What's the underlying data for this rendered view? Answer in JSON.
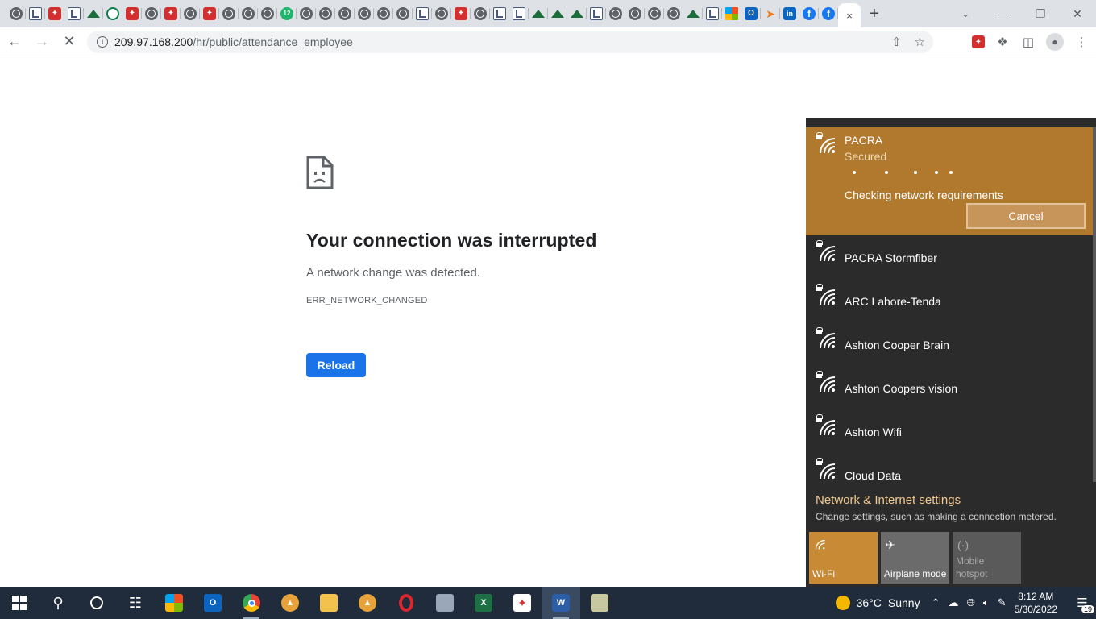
{
  "browser": {
    "tab_icons": [
      "globe",
      "doc",
      "pdf",
      "doc",
      "green",
      "ring",
      "pdf",
      "globe",
      "pdf",
      "globe",
      "pdf",
      "globe",
      "globe",
      "globe",
      "badge12",
      "globe",
      "globe",
      "globe",
      "globe",
      "globe",
      "globe",
      "doc",
      "globe",
      "pdf",
      "globe",
      "doc",
      "doc",
      "green",
      "green",
      "green",
      "doc",
      "globe",
      "globe",
      "globe",
      "globe",
      "green",
      "doc",
      "ms",
      "outlook",
      "arrow",
      "li",
      "fb",
      "fb"
    ],
    "tab_badge_text": "12",
    "active_tab_close": "×",
    "new_tab": "+",
    "url_host": "209.97.168.200",
    "url_path": "/hr/public/attendance_employee"
  },
  "error_page": {
    "title": "Your connection was interrupted",
    "description": "A network change was detected.",
    "code": "ERR_NETWORK_CHANGED",
    "reload_label": "Reload"
  },
  "network_flyout": {
    "active_network": {
      "name": "PACRA",
      "status": "Secured",
      "progress_text": "Checking network requirements",
      "cancel_label": "Cancel"
    },
    "networks": [
      {
        "name": "PACRA Stormfiber"
      },
      {
        "name": "ARC Lahore-Tenda"
      },
      {
        "name": "Ashton Cooper Brain"
      },
      {
        "name": "Ashton Coopers vision"
      },
      {
        "name": "Ashton Wifi"
      },
      {
        "name": "Cloud Data"
      }
    ],
    "settings_link": "Network & Internet settings",
    "settings_sub": "Change settings, such as making a connection metered.",
    "quick_actions": {
      "wifi": "Wi-Fi",
      "airplane": "Airplane mode",
      "hotspot_line1": "Mobile",
      "hotspot_line2": "hotspot"
    }
  },
  "taskbar": {
    "weather_temp": "36°C",
    "weather_text": "Sunny",
    "time": "8:12 AM",
    "date": "5/30/2022",
    "notification_count": "19"
  },
  "colors": {
    "flyout_accent": "#b0792d",
    "reload_blue": "#1a73e8",
    "taskbar_bg": "#202c3c"
  }
}
